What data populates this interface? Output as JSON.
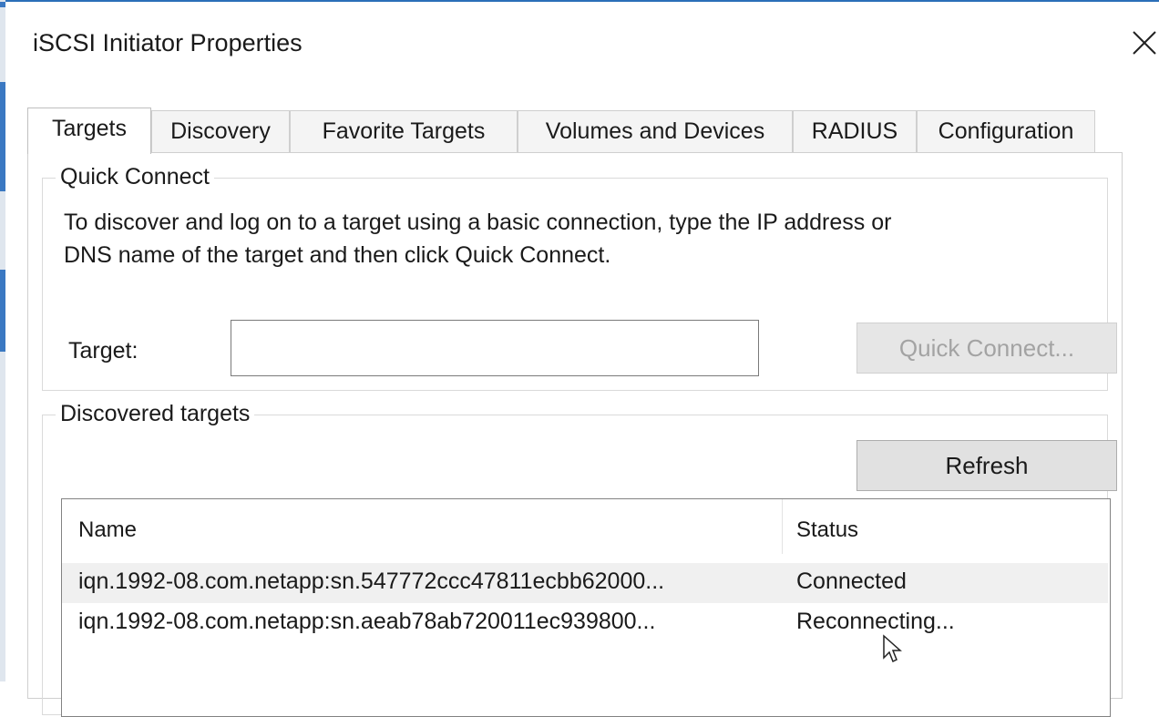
{
  "window": {
    "title": "iSCSI Initiator Properties",
    "close_icon": "close-icon"
  },
  "tabs": [
    {
      "label": "Targets",
      "active": true
    },
    {
      "label": "Discovery",
      "active": false
    },
    {
      "label": "Favorite Targets",
      "active": false
    },
    {
      "label": "Volumes and Devices",
      "active": false
    },
    {
      "label": "RADIUS",
      "active": false
    },
    {
      "label": "Configuration",
      "active": false
    }
  ],
  "quick_connect": {
    "legend": "Quick Connect",
    "description_line1": "To discover and log on to a target using a basic connection, type the IP address or",
    "description_line2": "DNS name of the target and then click Quick Connect.",
    "target_label": "Target:",
    "target_value": "",
    "button_label": "Quick Connect...",
    "button_enabled": false
  },
  "discovered_targets": {
    "legend": "Discovered targets",
    "refresh_label": "Refresh",
    "columns": [
      "Name",
      "Status"
    ],
    "rows": [
      {
        "name": "iqn.1992-08.com.netapp:sn.547772ccc47811ecbb62000...",
        "status": "Connected",
        "selected": true
      },
      {
        "name": "iqn.1992-08.com.netapp:sn.aeab78ab720011ec939800...",
        "status": "Reconnecting...",
        "selected": false
      }
    ]
  },
  "colors": {
    "accent": "#2b6fb8",
    "selected_row": "#f0f0f0",
    "button_face": "#e1e1e1"
  }
}
